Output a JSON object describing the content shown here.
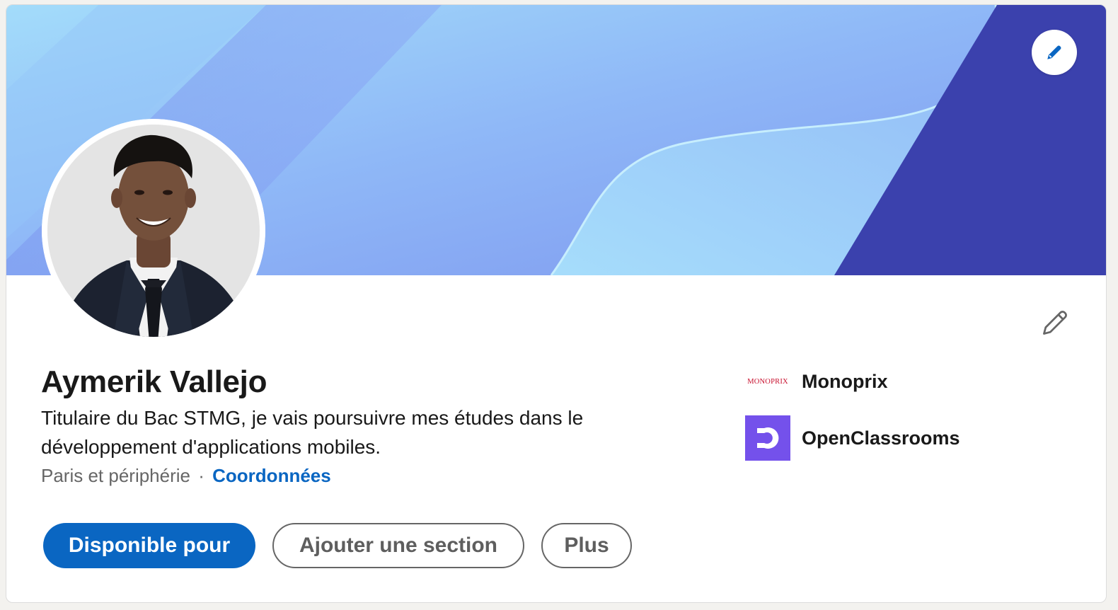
{
  "profile": {
    "name": "Aymerik Vallejo",
    "headline": "Titulaire du Bac STMG, je vais poursuivre mes études dans le développement d'applications mobiles.",
    "location": "Paris et périphérie",
    "separator": "·",
    "contact_label": "Coordonnées"
  },
  "actions": {
    "available_label": "Disponible pour",
    "add_section_label": "Ajouter une section",
    "more_label": "Plus"
  },
  "organizations": [
    {
      "name": "Monoprix",
      "logo_text": "MONOPRIX",
      "logo_color": "#c8102e"
    },
    {
      "name": "OpenClassrooms",
      "logo_color": "#7451eb"
    }
  ],
  "icons": {
    "cover_edit": "pencil-icon",
    "intro_edit": "pencil-icon"
  },
  "colors": {
    "primary": "#0a66c2",
    "banner_light": "#a7dcf9",
    "banner_mid": "#85a8f5",
    "banner_dark": "#3b41ad"
  }
}
